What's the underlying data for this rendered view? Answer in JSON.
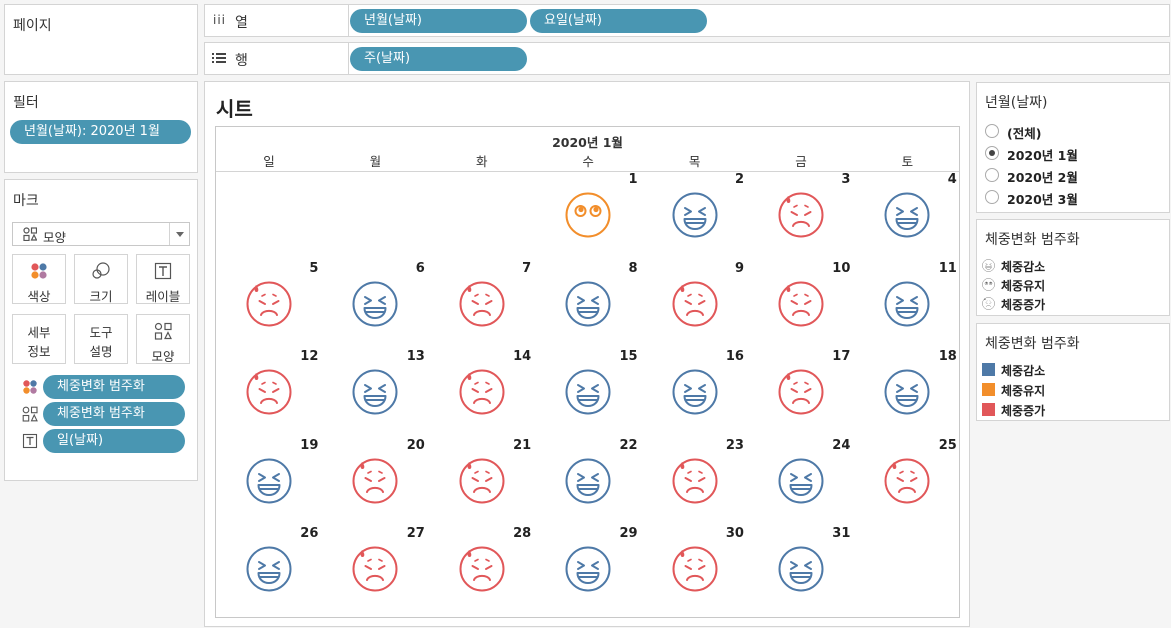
{
  "shelves": {
    "pages_title": "페이지",
    "columns_label": "열",
    "columns_pills": [
      "년월(날짜)",
      "요일(날짜)"
    ],
    "rows_label": "행",
    "rows_pills": [
      "주(날짜)"
    ]
  },
  "filters": {
    "title": "필터",
    "pill": "년월(날짜): 2020년 1월"
  },
  "marks": {
    "title": "마크",
    "type_dropdown": "모양",
    "buttons": {
      "color": "색상",
      "size": "크기",
      "label": "레이블",
      "detail_line1": "세부",
      "detail_line2": "정보",
      "tooltip_line1": "도구",
      "tooltip_line2": "설명",
      "shape": "모양"
    },
    "pills": [
      "체중변화 범주화",
      "체중변화 범주화",
      "일(날짜)"
    ]
  },
  "sheet": {
    "title": "시트",
    "month_header": "2020년 1월",
    "weekdays": [
      "일",
      "월",
      "화",
      "수",
      "목",
      "금",
      "토"
    ]
  },
  "filter_card": {
    "title": "년월(날짜)",
    "options": [
      "(전체)",
      "2020년 1월",
      "2020년 2월",
      "2020년 3월"
    ],
    "selected": "2020년 1월"
  },
  "shape_legend": {
    "title": "체중변화 범주화",
    "items": [
      {
        "label": "체중감소",
        "icon": "grin-face-icon"
      },
      {
        "label": "체중유지",
        "icon": "neutral-face-icon"
      },
      {
        "label": "체중증가",
        "icon": "sad-face-icon"
      }
    ]
  },
  "color_legend": {
    "title": "체중변화 범주화",
    "items": [
      {
        "label": "체중감소",
        "color": "#4e79a7"
      },
      {
        "label": "체중유지",
        "color": "#f28e2b"
      },
      {
        "label": "체중증가",
        "color": "#e15759"
      }
    ]
  },
  "chart_data": {
    "type": "table",
    "title": "시트",
    "month": "2020년 1월",
    "columns": [
      "일",
      "월",
      "화",
      "수",
      "목",
      "금",
      "토"
    ],
    "first_weekday_index": 3,
    "days": [
      {
        "day": 1,
        "category": "체중유지"
      },
      {
        "day": 2,
        "category": "체중감소"
      },
      {
        "day": 3,
        "category": "체중증가"
      },
      {
        "day": 4,
        "category": "체중감소"
      },
      {
        "day": 5,
        "category": "체중증가"
      },
      {
        "day": 6,
        "category": "체중감소"
      },
      {
        "day": 7,
        "category": "체중증가"
      },
      {
        "day": 8,
        "category": "체중감소"
      },
      {
        "day": 9,
        "category": "체중증가"
      },
      {
        "day": 10,
        "category": "체중증가"
      },
      {
        "day": 11,
        "category": "체중감소"
      },
      {
        "day": 12,
        "category": "체중증가"
      },
      {
        "day": 13,
        "category": "체중감소"
      },
      {
        "day": 14,
        "category": "체중증가"
      },
      {
        "day": 15,
        "category": "체중감소"
      },
      {
        "day": 16,
        "category": "체중감소"
      },
      {
        "day": 17,
        "category": "체중증가"
      },
      {
        "day": 18,
        "category": "체중감소"
      },
      {
        "day": 19,
        "category": "체중감소"
      },
      {
        "day": 20,
        "category": "체중증가"
      },
      {
        "day": 21,
        "category": "체중증가"
      },
      {
        "day": 22,
        "category": "체중감소"
      },
      {
        "day": 23,
        "category": "체중증가"
      },
      {
        "day": 24,
        "category": "체중감소"
      },
      {
        "day": 25,
        "category": "체중증가"
      },
      {
        "day": 26,
        "category": "체중감소"
      },
      {
        "day": 27,
        "category": "체중증가"
      },
      {
        "day": 28,
        "category": "체중증가"
      },
      {
        "day": 29,
        "category": "체중감소"
      },
      {
        "day": 30,
        "category": "체중증가"
      },
      {
        "day": 31,
        "category": "체중감소"
      }
    ],
    "colors": {
      "체중감소": "#4e79a7",
      "체중유지": "#f28e2b",
      "체중증가": "#e15759"
    }
  }
}
